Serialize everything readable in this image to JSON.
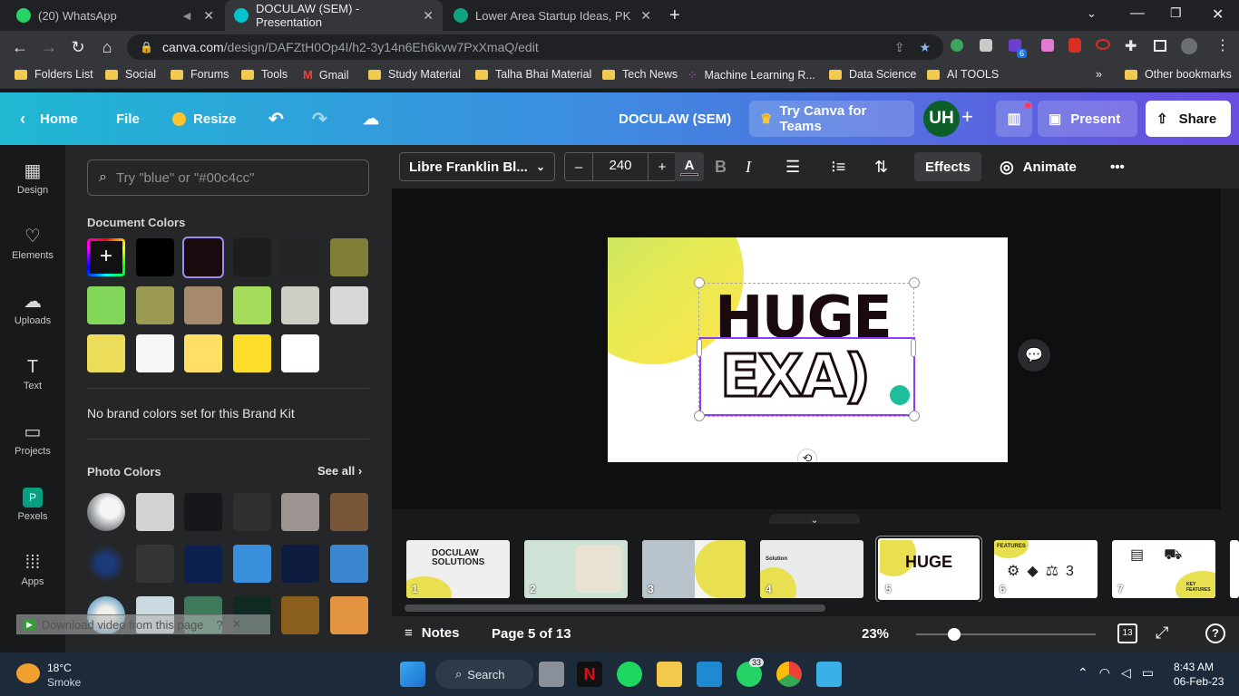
{
  "browser": {
    "tabs": [
      {
        "title": "(20) WhatsApp",
        "active": false
      },
      {
        "title": "DOCULAW (SEM) - Presentation",
        "active": true
      },
      {
        "title": "Lower Area Startup Ideas, PK",
        "active": false
      }
    ],
    "url_domain": "canva.com",
    "url_path": "/design/DAFZtH0Op4I/h2-3y14n6Eh6kvw7PxXmaQ/edit",
    "bookmarks": [
      "Folders List",
      "Social",
      "Forums",
      "Tools",
      "Gmail",
      "Study Material",
      "Talha Bhai Material",
      "Tech News",
      "Machine Learning R...",
      "Data Science",
      "AI TOOLS"
    ],
    "other_bookmarks": "Other bookmarks",
    "ext_badge": "6"
  },
  "header": {
    "home": "Home",
    "file": "File",
    "resize": "Resize",
    "doc_title": "DOCULAW (SEM)",
    "try_teams": "Try Canva for Teams",
    "avatar": "UH",
    "present": "Present",
    "share": "Share"
  },
  "rail": [
    {
      "label": "Design",
      "icon": "design-icon"
    },
    {
      "label": "Elements",
      "icon": "elements-icon"
    },
    {
      "label": "Uploads",
      "icon": "uploads-icon"
    },
    {
      "label": "Text",
      "icon": "text-icon"
    },
    {
      "label": "Projects",
      "icon": "projects-icon"
    },
    {
      "label": "Pexels",
      "icon": "pexels-icon"
    },
    {
      "label": "Apps",
      "icon": "apps-icon"
    }
  ],
  "panel": {
    "search_placeholder": "Try \"blue\" or \"#00c4cc\"",
    "document_colors_title": "Document Colors",
    "document_colors": [
      "#000000",
      "#1a0a0d",
      "#1c1d1f",
      "#222524",
      "#7f7f38",
      "#82d65a",
      "#9a9a55",
      "#a68a6e",
      "#a6dc5c",
      "#ccd0c4",
      "#d6d8da",
      "#ebdd5a",
      "#f7f7f7",
      "#ffe065",
      "#ffde2b",
      "#ffffff"
    ],
    "no_brand": "No brand colors set for this Brand Kit",
    "photo_colors_title": "Photo Colors",
    "see_all": "See all",
    "photo_colors_row1": [
      "#d2d1d4",
      "#16171a",
      "#2e2f31",
      "#9b9490",
      "#7a5638"
    ],
    "photo_colors_row2": [
      "#333436",
      "#0d2150",
      "#3a8fdc",
      "#0e1c40",
      "#3c86d0"
    ],
    "photo_colors_row3": [
      "#cbd9e0",
      "#3d7a5c",
      "#0f2a22",
      "#8a5f1b",
      "#e39440"
    ],
    "download_overlay": "Download video from this page"
  },
  "toolbar": {
    "font": "Libre Franklin Bl...",
    "minus": "–",
    "size": "240",
    "plus": "+",
    "text_color_glyph": "A",
    "bold": "B",
    "italic": "I",
    "effects": "Effects",
    "animate": "Animate",
    "more": "•••"
  },
  "slide": {
    "headline": "HUGE",
    "subline": "EXA)"
  },
  "filmstrip": [
    {
      "num": "1",
      "label": "DOCULAW SOLUTIONS"
    },
    {
      "num": "2",
      "label": ""
    },
    {
      "num": "3",
      "label": ""
    },
    {
      "num": "4",
      "label": "Solution"
    },
    {
      "num": "5",
      "label": "HUGE"
    },
    {
      "num": "6",
      "label": "FEATURES"
    },
    {
      "num": "7",
      "label": "KEY FEATURES"
    }
  ],
  "bottom": {
    "notes": "Notes",
    "page": "Page 5 of 13",
    "zoom": "23%",
    "zoom_fraction": 0.21,
    "pages_badge": "13",
    "help": "?"
  },
  "taskbar": {
    "temp": "18°C",
    "weather": "Smoke",
    "search": "Search",
    "whatsapp_badge": "33",
    "time": "8:43 AM",
    "date": "06-Feb-23"
  }
}
